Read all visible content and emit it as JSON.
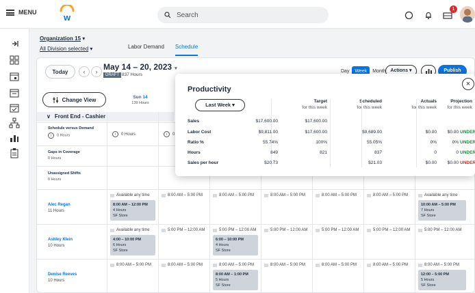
{
  "topbar": {
    "menu_label": "MENU",
    "search_placeholder": "Search",
    "notification_count": "1"
  },
  "org": {
    "name": "Organization 15",
    "division": "All Division selected"
  },
  "tabs": [
    {
      "label": "Labor Demand"
    },
    {
      "label": "Schedule"
    }
  ],
  "toolbar": {
    "today": "Today",
    "date_range": "May 14 – 20, 2023",
    "status": "DRAFT",
    "hours": "837 Hours",
    "views": [
      "Day",
      "Week",
      "Month"
    ],
    "actions": "Actions",
    "publish": "Publish"
  },
  "change_view": "Change View",
  "days": [
    {
      "day": "Sun 14",
      "hours": "139 Hours"
    }
  ],
  "section": "Front End - Cashier",
  "summary_rows": [
    {
      "label": "Schedule versus Demand",
      "value": "0 Hours",
      "cell": "0 Hours",
      "cell2": "0 H"
    },
    {
      "label": "Gaps in Coverage",
      "value": "0 Hours"
    },
    {
      "label": "Unassigned Shifts",
      "value": "0 Hours"
    }
  ],
  "employees": [
    {
      "name": "Alec Regan",
      "hours": "11 Hours",
      "cells": [
        "Available any time",
        "8:00 AM – 5:00 PM",
        "8:00 AM – 5:00 PM",
        "8:00 AM – 5:00 PM",
        "8:00 AM – 5:00 PM",
        "8:00 AM – 5:00 PM",
        "Available any time"
      ],
      "shifts": [
        {
          "time": "8:00 AM – 12:00 PM",
          "hours": "4 Hours",
          "store": "SF Store"
        },
        {
          "time": "10:00 AM – 5:00 PM",
          "hours": "7 Hours",
          "store": "SF Store"
        }
      ]
    },
    {
      "name": "Ashley Klein",
      "hours": "10 Hours",
      "cells": [
        "Available any time",
        "5:00 PM – 12:00 AM",
        "5:00 PM – 12:00 AM",
        "5:00 PM – 12:00 AM",
        "5:00 PM – 12:00 AM",
        "5:00 PM – 12:00 AM",
        "5:00 PM – 12:00 AM"
      ],
      "shifts": [
        {
          "time": "4:00 – 10:00 PM",
          "hours": "6 Hours",
          "store": "SF Store"
        },
        {
          "time": "6:00 – 10:00 PM",
          "hours": "4 Hours",
          "store": "SF Store"
        }
      ]
    },
    {
      "name": "Denise Reeves",
      "hours": "10 Hours",
      "cells": [
        "8:00 AM – 5:00 PM",
        "8:00 AM – 5:00 PM",
        "8:00 AM – 5:00 PM",
        "8:00 AM – 5:00 PM",
        "8:00 AM – 5:00 PM",
        "8:00 AM – 5:00 PM",
        "8:00 AM – 5:00 PM"
      ],
      "shifts": [
        {
          "time": "8:00 AM – 1:00 PM",
          "hours": "5 Hours",
          "store": "SF Store"
        },
        {
          "time": "12:00 – 5:00 PM",
          "hours": "5 Hours",
          "store": "SF Store"
        }
      ]
    }
  ],
  "productivity": {
    "title": "Productivity",
    "period": "Last Week",
    "columns": [
      {
        "title": "Target",
        "sub": "for this week"
      },
      {
        "title": "Scheduled",
        "sub": "for this week"
      },
      {
        "title": "Actuals",
        "sub": "for this week"
      },
      {
        "title": "Projection",
        "sub": "for this week"
      }
    ],
    "rows": [
      {
        "label": "Sales",
        "base": "$17,600.00",
        "target": "$17,600.00",
        "scheduled": "",
        "actuals": "",
        "projection": "",
        "flag": ""
      },
      {
        "label": "Labor Cost",
        "base": "$9,811.00",
        "target": "$17,600.00",
        "scheduled": "$9,689.00",
        "actuals": "$0.00",
        "projection": "$0.00",
        "flag": "UNDER"
      },
      {
        "label": "Ratio %",
        "base": "55.74%",
        "target": "100%",
        "scheduled": "55.05%",
        "actuals": "0%",
        "projection": "0%",
        "flag": "UNDER"
      },
      {
        "label": "Hours",
        "base": "849",
        "target": "821",
        "scheduled": "837",
        "actuals": "0",
        "projection": "0",
        "flag": "UNDER"
      },
      {
        "label": "Sales per hour",
        "base": "$20.73",
        "target": "",
        "scheduled": "$21.03",
        "actuals": "$0.00",
        "projection": "$0.00",
        "flag": "UNDER"
      }
    ]
  },
  "colors": {
    "accent": "#0875e1",
    "under_green": "#1e8a3c",
    "under_red": "#cc2929",
    "badge": "#de2c2c"
  }
}
